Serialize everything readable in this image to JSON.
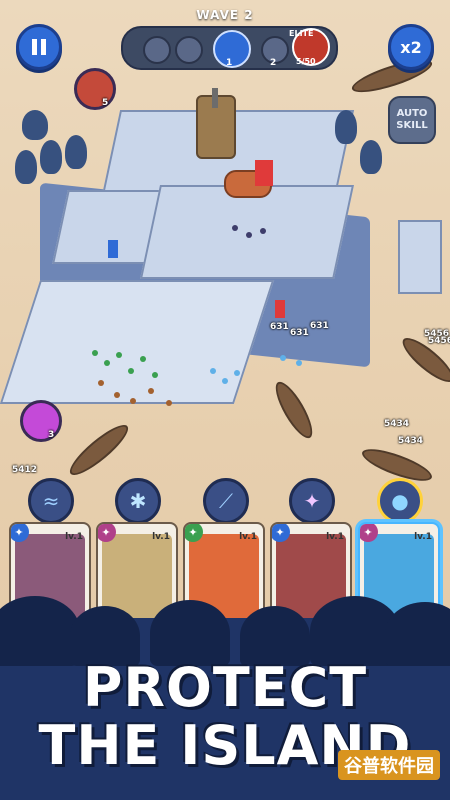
{
  "hud": {
    "wave_label": "WAVE 2",
    "speed_label": "x2",
    "auto_skill_label": "AUTO SKILL",
    "wave_track": [
      {
        "icon": "wave-shield-icon",
        "num": ""
      },
      {
        "icon": "wave-sword-icon",
        "num": ""
      },
      {
        "icon": "wave-current-icon",
        "num": "1"
      },
      {
        "icon": "wave-shield-icon",
        "num": "2"
      }
    ],
    "elite_label": "ELITE",
    "elite_hp": "5/50"
  },
  "battle": {
    "enemy_count_top": "5",
    "enemy_count_left": "3",
    "unit_hp_a": "631",
    "unit_hp_b": "631",
    "unit_hp_c": "631",
    "boat_hp_left": "5412",
    "boat_hp_right_a": "5434",
    "boat_hp_right_b": "5434",
    "boat_hp_far_a": "5456",
    "boat_hp_far_b": "5456"
  },
  "skills": [
    {
      "icon": "wind-slash-icon"
    },
    {
      "icon": "frost-burst-icon"
    },
    {
      "icon": "blade-rain-icon"
    },
    {
      "icon": "spirit-icon"
    },
    {
      "icon": "water-blob-icon",
      "selected": true
    }
  ],
  "cards": [
    {
      "level": "lv.1",
      "tag_color": "#2f6bd6",
      "art_color": "#8b5a7a"
    },
    {
      "level": "lv.1",
      "tag_color": "#b0408a",
      "art_color": "#c9b07a"
    },
    {
      "level": "lv.1",
      "tag_color": "#3aa050",
      "art_color": "#e06a3a"
    },
    {
      "level": "lv.1",
      "tag_color": "#2f6bd6",
      "art_color": "#a04a4a"
    },
    {
      "level": "lv.1",
      "tag_color": "#b0408a",
      "art_color": "#4aa8e0",
      "selected": true
    }
  ],
  "banner": {
    "line1": "PROTECT",
    "line2": "THE ISLAND"
  },
  "watermark": "谷普软件园",
  "colors": {
    "hud_blue": "#2f6bd6",
    "banner_navy": "#1f3466",
    "sand": "#e7cfae"
  }
}
